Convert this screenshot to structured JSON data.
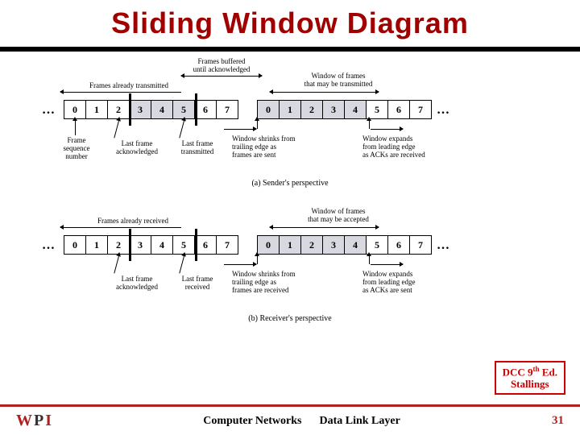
{
  "title": "Sliding Window Diagram",
  "sender": {
    "buffered_label": "Frames buffered\nuntil acknowledged",
    "transmitted_label": "Frames already transmitted",
    "window_label": "Window of frames\nthat may be transmitted",
    "cells_left": [
      "0",
      "1",
      "2",
      "3",
      "4",
      "5",
      "6",
      "7"
    ],
    "cells_right": [
      "0",
      "1",
      "2",
      "3",
      "4",
      "5",
      "6",
      "7"
    ],
    "frame_seq_label": "Frame\nsequence\nnumber",
    "last_ack_label": "Last frame\nacknowledged",
    "last_tx_label": "Last frame\ntransmitted",
    "shrink_label": "Window shrinks from\ntrailing edge as\nframes are sent",
    "expand_label": "Window expands\nfrom leading edge\nas ACKs are received",
    "caption": "(a) Sender's perspective"
  },
  "receiver": {
    "received_label": "Frames already received",
    "window_label": "Window of frames\nthat may be accepted",
    "cells_left": [
      "0",
      "1",
      "2",
      "3",
      "4",
      "5",
      "6",
      "7"
    ],
    "cells_right": [
      "0",
      "1",
      "2",
      "3",
      "4",
      "5",
      "6",
      "7"
    ],
    "last_ack_label": "Last frame\nacknowledged",
    "last_rx_label": "Last frame\nreceived",
    "shrink_label": "Window shrinks from\ntrailing edge as\nframes are received",
    "expand_label": "Window expands\nfrom leading edge\nas ACKs are sent",
    "caption": "(b) Receiver's perspective"
  },
  "source": {
    "line1": "DCC 9",
    "sup": "th",
    "line1b": " Ed.",
    "line2": "Stallings"
  },
  "footer": {
    "left": "Computer Networks",
    "right": "Data Link Layer",
    "page": "31"
  },
  "dots": "…"
}
